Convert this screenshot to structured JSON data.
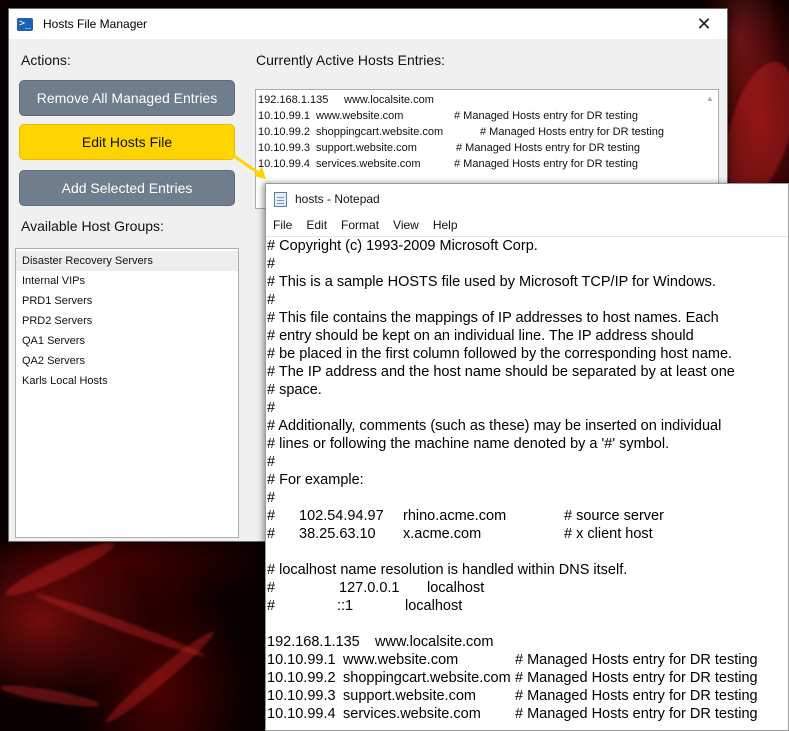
{
  "manager": {
    "title": "Hosts File Manager",
    "icon": "powershell-icon",
    "close_glyph": "✕",
    "actions_label": "Actions:",
    "buttons": {
      "remove_all": "Remove All Managed Entries",
      "edit_hosts": "Edit Hosts File",
      "add_selected": "Add Selected Entries"
    },
    "groups_label": "Available Host Groups:",
    "groups": [
      "Disaster Recovery Servers",
      "Internal VIPs",
      "PRD1 Servers",
      "PRD2 Servers",
      "QA1 Servers",
      "QA2 Servers",
      "Karls Local Hosts"
    ],
    "selected_group": "Disaster Recovery Servers",
    "entries_label": "Currently Active Hosts Entries:",
    "entries": [
      {
        "ip": "192.168.1.135",
        "host": "www.localsite.com",
        "comment": ""
      },
      {
        "ip": "10.10.99.1",
        "host": "www.website.com",
        "comment": "# Managed Hosts entry for DR testing"
      },
      {
        "ip": "10.10.99.2",
        "host": "shoppingcart.website.com",
        "comment": "# Managed Hosts entry for DR testing"
      },
      {
        "ip": "10.10.99.3",
        "host": "support.website.com",
        "comment": "# Managed Hosts entry for DR testing"
      },
      {
        "ip": "10.10.99.4",
        "host": "services.website.com",
        "comment": "# Managed Hosts entry for DR testing"
      }
    ],
    "colors": {
      "accent_yellow": "#ffd400",
      "button_grey": "#6f7d8c"
    }
  },
  "notepad": {
    "title": "hosts - Notepad",
    "menu": [
      "File",
      "Edit",
      "Format",
      "View",
      "Help"
    ],
    "lines": [
      [
        "# Copyright (c) 1993-2009 Microsoft Corp."
      ],
      [
        "#"
      ],
      [
        "# This is a sample HOSTS file used by Microsoft TCP/IP for Windows."
      ],
      [
        "#"
      ],
      [
        "# This file contains the mappings of IP addresses to host names. Each"
      ],
      [
        "# entry should be kept on an individual line. The IP address should"
      ],
      [
        "# be placed in the first column followed by the corresponding host name."
      ],
      [
        "# The IP address and the host name should be separated by at least one"
      ],
      [
        "# space."
      ],
      [
        "#"
      ],
      [
        "# Additionally, comments (such as these) may be inserted on individual"
      ],
      [
        "# lines or following the machine name denoted by a '#' symbol."
      ],
      [
        "#"
      ],
      [
        "# For example:"
      ],
      [
        "#"
      ],
      [
        "#",
        "102.54.94.97",
        "rhino.acme.com",
        "# source server"
      ],
      [
        "#",
        "38.25.63.10",
        "x.acme.com",
        "# x client host"
      ],
      [
        ""
      ],
      [
        "# localhost name resolution is handled within DNS itself."
      ],
      [
        "#",
        "127.0.0.1",
        "localhost"
      ],
      [
        "#",
        "::1",
        "localhost"
      ],
      [
        ""
      ],
      [
        "192.168.1.135",
        "www.localsite.com"
      ],
      [
        "10.10.99.1",
        "www.website.com",
        "# Managed Hosts entry for DR testing"
      ],
      [
        "10.10.99.2",
        "shoppingcart.website.com",
        "# Managed Hosts entry for DR testing"
      ],
      [
        "10.10.99.3",
        "support.website.com",
        "# Managed Hosts entry for DR testing"
      ],
      [
        "10.10.99.4",
        "services.website.com",
        "# Managed Hosts entry for DR testing"
      ]
    ]
  }
}
